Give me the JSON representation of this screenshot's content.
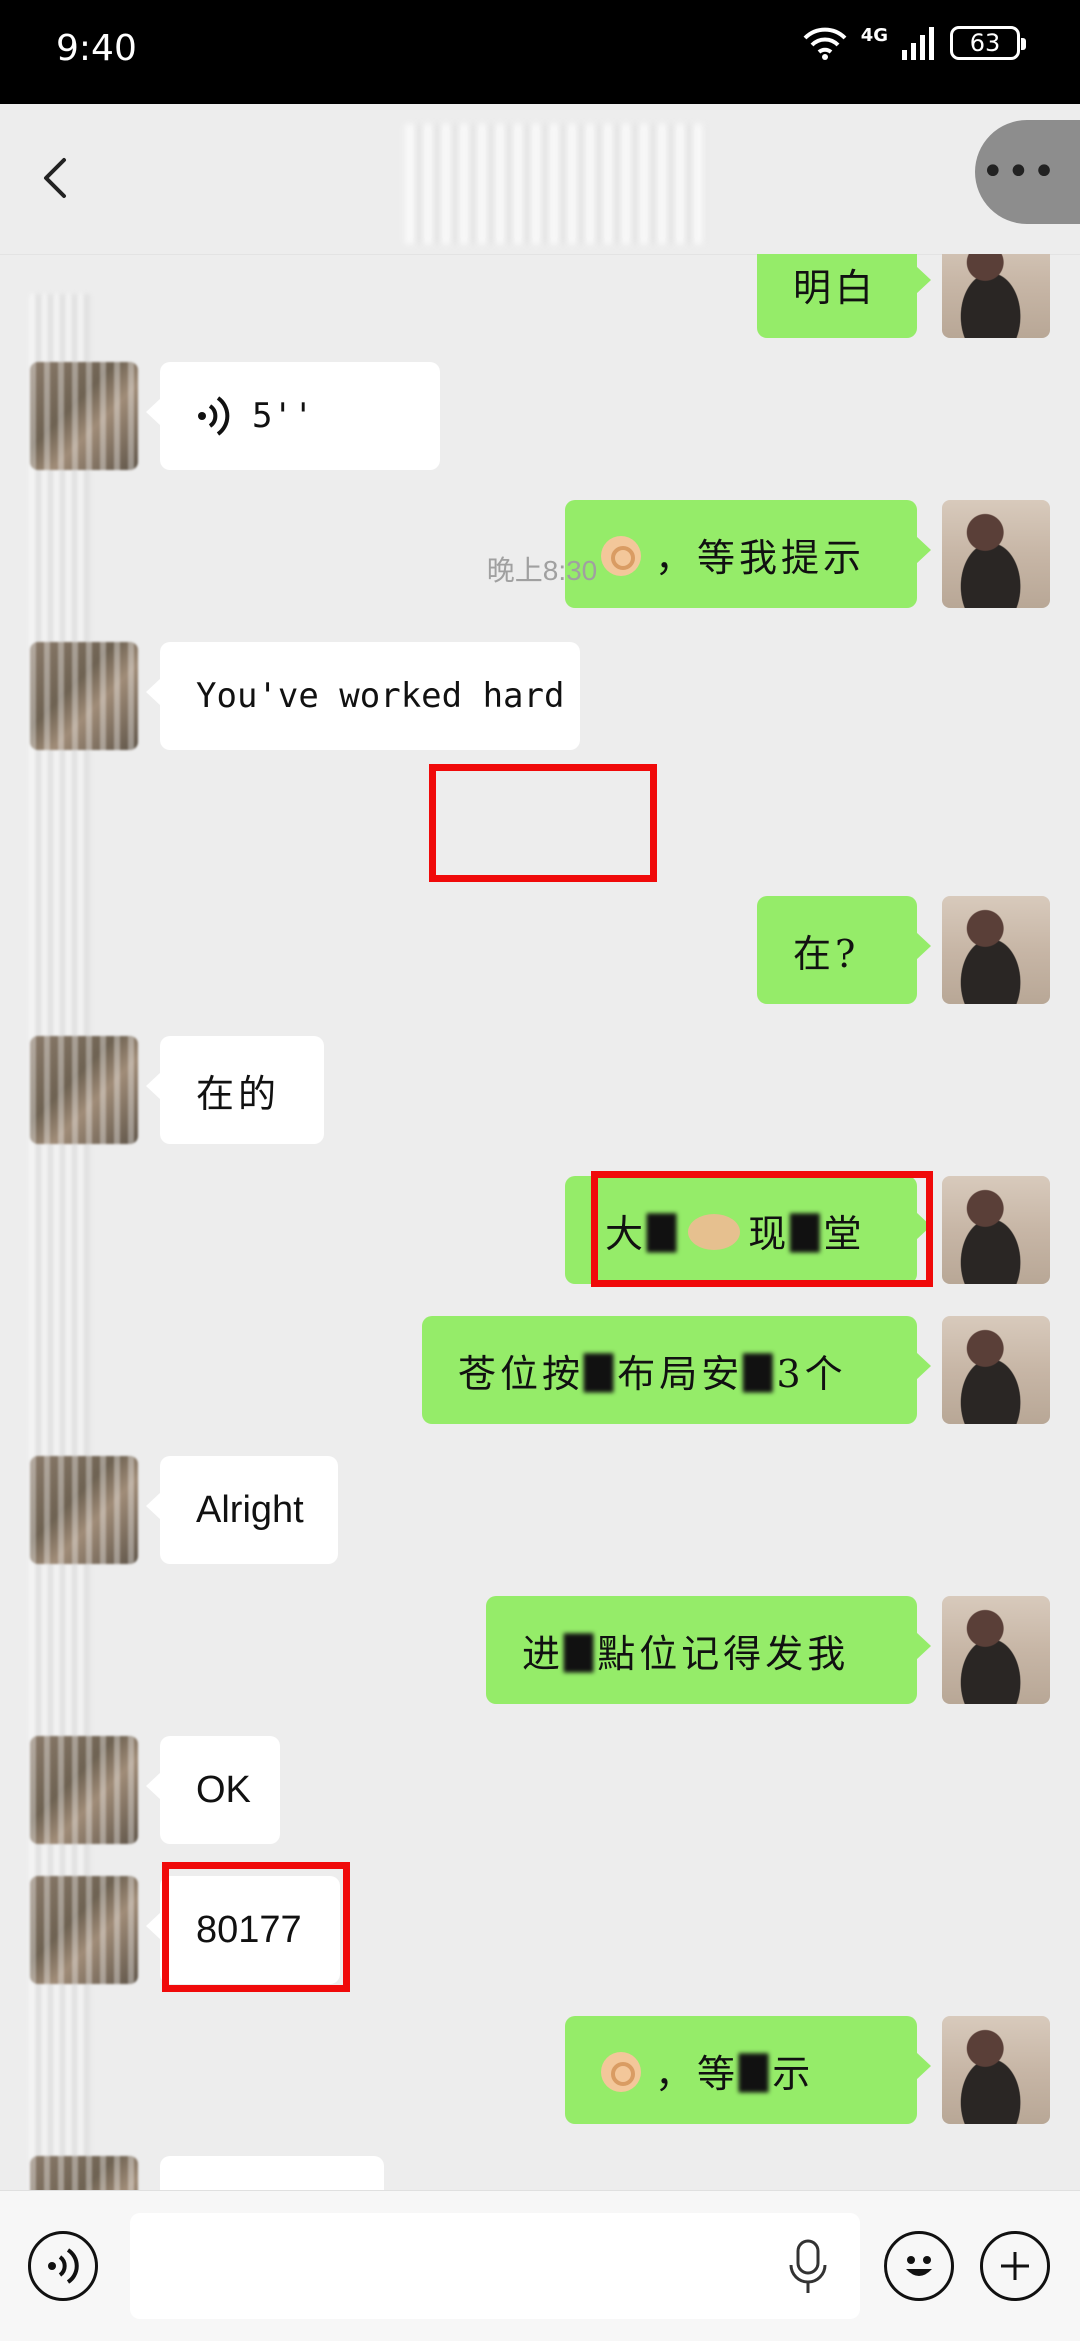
{
  "status_bar": {
    "time": "9:40",
    "network": "4G",
    "battery": "63"
  },
  "header": {
    "title": ""
  },
  "messages": {
    "m1": {
      "text": "明白"
    },
    "m2": {
      "duration": "5''"
    },
    "m3": {
      "text": "，等我提示"
    },
    "m4": {
      "text": "You've worked hard"
    },
    "timestamp": "晚上8:30",
    "m5": {
      "text": "在?"
    },
    "m6": {
      "text": "在的"
    },
    "m7": {
      "text_a": "大",
      "text_b": "现",
      "text_c": "堂"
    },
    "m8": {
      "text": "苍位按",
      "text_b": "布局安",
      "text_c": "3个"
    },
    "m9": {
      "text": "Alright"
    },
    "m10": {
      "text_a": "进",
      "text_b": "點位记得发我"
    },
    "m11": {
      "text": "OK"
    },
    "m12": {
      "text": "80177"
    },
    "m13": {
      "text_a": "，等",
      "text_b": "示"
    }
  },
  "input": {
    "placeholder": ""
  },
  "icons": {
    "back": "chevron-left-icon",
    "more": "more-dots-icon",
    "voice": "voice-icon",
    "mic": "mic-icon",
    "emoji": "emoji-icon",
    "plus": "plus-icon"
  },
  "colors": {
    "bubble_out": "#95EC69",
    "bubble_in": "#FFFFFF",
    "background": "#EDEDED",
    "highlight": "#F00A0A"
  }
}
